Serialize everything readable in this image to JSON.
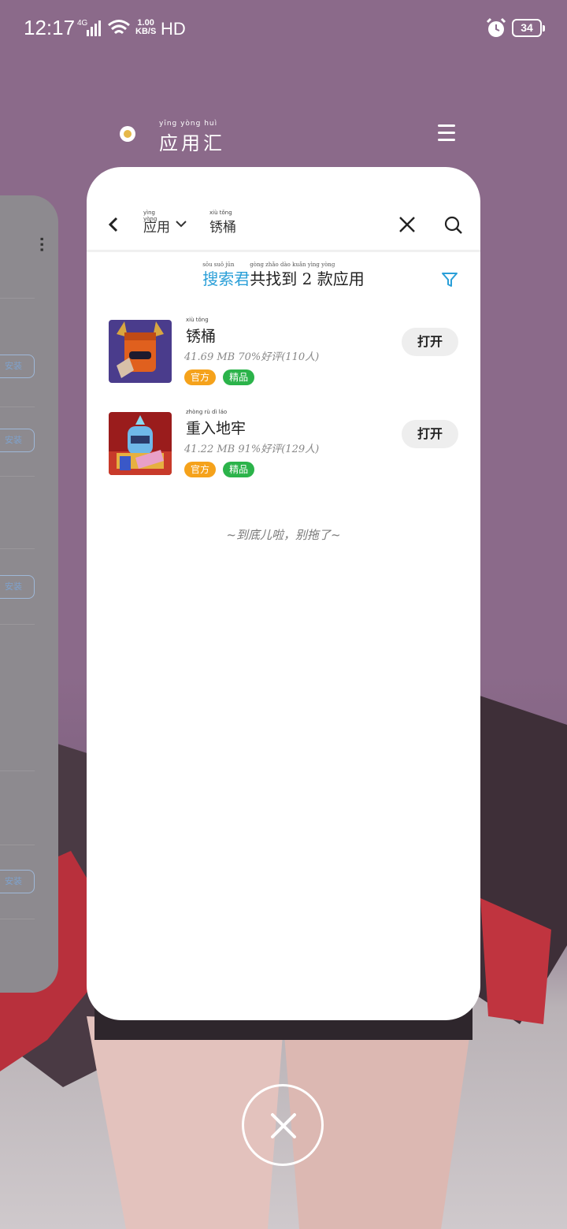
{
  "status_bar": {
    "time": "12:17",
    "network": "4G",
    "speed_top": "1.00",
    "speed_bottom": "KB/S",
    "hd": "HD",
    "battery": "34"
  },
  "app_header": {
    "title": "应用汇",
    "title_pinyin": "yīng yòng huì"
  },
  "recent_card_left": {
    "more": "···",
    "button_label": "安装"
  },
  "search_card": {
    "category": "应用",
    "category_pinyin": "yìng yòng",
    "keyword": "锈桶",
    "keyword_pinyin": "xiù tǒng",
    "summary_brand": "搜索君",
    "summary_brand_pinyin": "sōu suǒ jūn",
    "summary_text": "共找到 2 款应用",
    "summary_text_pinyin": "gòng zhǎo dào kuǎn yìng yòng",
    "results": [
      {
        "name": "锈桶",
        "name_pinyin": "xiù tǒng",
        "meta": "41.69 MB  70%好评(110人)",
        "tags": [
          "官方",
          "精品"
        ],
        "action": "打开"
      },
      {
        "name": "重入地牢",
        "name_pinyin": "zhòng rù dì láo",
        "meta": "41.22 MB  91%好评(129人)",
        "tags": [
          "官方",
          "精品"
        ],
        "action": "打开"
      }
    ],
    "footer_note": "~到底儿啦，别拖了~"
  },
  "colors": {
    "accent_blue": "#2a9fd8",
    "tag_orange": "#f5a21b",
    "tag_green": "#2bb34a",
    "wallpaper": "#8a6a8c"
  },
  "icons": [
    "signal-icon",
    "wifi-icon",
    "alarm-icon",
    "battery-icon",
    "menu-icon",
    "back-arrow-icon",
    "chevron-down-icon",
    "close-icon",
    "search-icon",
    "filter-icon",
    "close-all-icon"
  ]
}
